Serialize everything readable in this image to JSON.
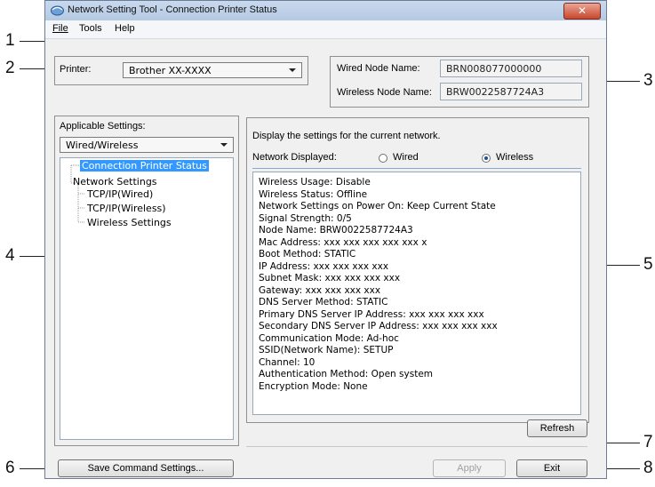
{
  "callouts": [
    "1",
    "2",
    "3",
    "4",
    "5",
    "6",
    "7",
    "8"
  ],
  "window": {
    "title": "Network Setting Tool - Connection Printer Status",
    "close_label": "✕"
  },
  "menu": {
    "file": "File",
    "tools": "Tools",
    "help": "Help"
  },
  "printer": {
    "label": "Printer:",
    "value": "Brother XX-XXXX"
  },
  "nodes": {
    "wired_label": "Wired Node Name:",
    "wired_value": "BRN008077000000",
    "wireless_label": "Wireless Node Name:",
    "wireless_value": "BRW0022587724A3"
  },
  "applicable": {
    "label": "Applicable Settings:",
    "value": "Wired/Wireless",
    "tree": [
      "Connection Printer Status",
      "Network Settings",
      "TCP/IP(Wired)",
      "TCP/IP(Wireless)",
      "Wireless Settings"
    ]
  },
  "status": {
    "description": "Display the settings for the current network.",
    "network_displayed_label": "Network Displayed:",
    "radio_wired": "Wired",
    "radio_wireless": "Wireless",
    "selected": "Wireless",
    "lines": [
      "Wireless Usage: Disable",
      "Wireless Status: Offline",
      "Network Settings on Power On: Keep Current State",
      "Signal Strength: 0/5",
      "Node Name: BRW0022587724A3",
      "Mac Address: xxx xxx xxx xxx xxx x",
      "Boot Method: STATIC",
      "IP Address: xxx xxx xxx xxx",
      "Subnet Mask: xxx xxx xxx xxx",
      "Gateway: xxx xxx xxx xxx",
      "DNS Server Method: STATIC",
      "Primary DNS Server IP Address: xxx xxx xxx xxx",
      "Secondary DNS Server IP Address: xxx xxx xxx xxx",
      "Communication Mode: Ad-hoc",
      "SSID(Network Name): SETUP",
      "Channel: 10",
      "Authentication Method: Open system",
      "Encryption Mode: None"
    ]
  },
  "buttons": {
    "refresh": "Refresh",
    "save": "Save Command Settings...",
    "apply": "Apply",
    "exit": "Exit"
  }
}
